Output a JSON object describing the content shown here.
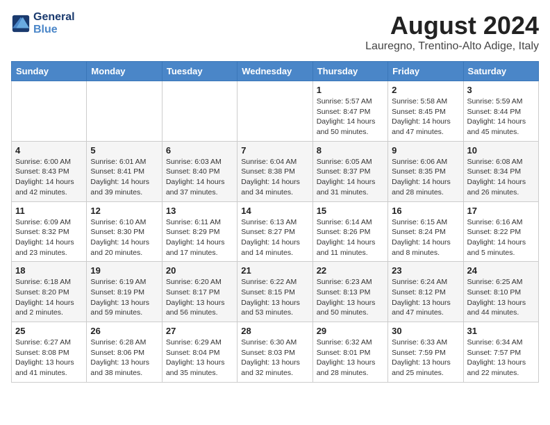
{
  "header": {
    "logo_line1": "General",
    "logo_line2": "Blue",
    "month_year": "August 2024",
    "location": "Lauregno, Trentino-Alto Adige, Italy"
  },
  "weekdays": [
    "Sunday",
    "Monday",
    "Tuesday",
    "Wednesday",
    "Thursday",
    "Friday",
    "Saturday"
  ],
  "weeks": [
    [
      {
        "day": "",
        "info": ""
      },
      {
        "day": "",
        "info": ""
      },
      {
        "day": "",
        "info": ""
      },
      {
        "day": "",
        "info": ""
      },
      {
        "day": "1",
        "info": "Sunrise: 5:57 AM\nSunset: 8:47 PM\nDaylight: 14 hours\nand 50 minutes."
      },
      {
        "day": "2",
        "info": "Sunrise: 5:58 AM\nSunset: 8:45 PM\nDaylight: 14 hours\nand 47 minutes."
      },
      {
        "day": "3",
        "info": "Sunrise: 5:59 AM\nSunset: 8:44 PM\nDaylight: 14 hours\nand 45 minutes."
      }
    ],
    [
      {
        "day": "4",
        "info": "Sunrise: 6:00 AM\nSunset: 8:43 PM\nDaylight: 14 hours\nand 42 minutes."
      },
      {
        "day": "5",
        "info": "Sunrise: 6:01 AM\nSunset: 8:41 PM\nDaylight: 14 hours\nand 39 minutes."
      },
      {
        "day": "6",
        "info": "Sunrise: 6:03 AM\nSunset: 8:40 PM\nDaylight: 14 hours\nand 37 minutes."
      },
      {
        "day": "7",
        "info": "Sunrise: 6:04 AM\nSunset: 8:38 PM\nDaylight: 14 hours\nand 34 minutes."
      },
      {
        "day": "8",
        "info": "Sunrise: 6:05 AM\nSunset: 8:37 PM\nDaylight: 14 hours\nand 31 minutes."
      },
      {
        "day": "9",
        "info": "Sunrise: 6:06 AM\nSunset: 8:35 PM\nDaylight: 14 hours\nand 28 minutes."
      },
      {
        "day": "10",
        "info": "Sunrise: 6:08 AM\nSunset: 8:34 PM\nDaylight: 14 hours\nand 26 minutes."
      }
    ],
    [
      {
        "day": "11",
        "info": "Sunrise: 6:09 AM\nSunset: 8:32 PM\nDaylight: 14 hours\nand 23 minutes."
      },
      {
        "day": "12",
        "info": "Sunrise: 6:10 AM\nSunset: 8:30 PM\nDaylight: 14 hours\nand 20 minutes."
      },
      {
        "day": "13",
        "info": "Sunrise: 6:11 AM\nSunset: 8:29 PM\nDaylight: 14 hours\nand 17 minutes."
      },
      {
        "day": "14",
        "info": "Sunrise: 6:13 AM\nSunset: 8:27 PM\nDaylight: 14 hours\nand 14 minutes."
      },
      {
        "day": "15",
        "info": "Sunrise: 6:14 AM\nSunset: 8:26 PM\nDaylight: 14 hours\nand 11 minutes."
      },
      {
        "day": "16",
        "info": "Sunrise: 6:15 AM\nSunset: 8:24 PM\nDaylight: 14 hours\nand 8 minutes."
      },
      {
        "day": "17",
        "info": "Sunrise: 6:16 AM\nSunset: 8:22 PM\nDaylight: 14 hours\nand 5 minutes."
      }
    ],
    [
      {
        "day": "18",
        "info": "Sunrise: 6:18 AM\nSunset: 8:20 PM\nDaylight: 14 hours\nand 2 minutes."
      },
      {
        "day": "19",
        "info": "Sunrise: 6:19 AM\nSunset: 8:19 PM\nDaylight: 13 hours\nand 59 minutes."
      },
      {
        "day": "20",
        "info": "Sunrise: 6:20 AM\nSunset: 8:17 PM\nDaylight: 13 hours\nand 56 minutes."
      },
      {
        "day": "21",
        "info": "Sunrise: 6:22 AM\nSunset: 8:15 PM\nDaylight: 13 hours\nand 53 minutes."
      },
      {
        "day": "22",
        "info": "Sunrise: 6:23 AM\nSunset: 8:13 PM\nDaylight: 13 hours\nand 50 minutes."
      },
      {
        "day": "23",
        "info": "Sunrise: 6:24 AM\nSunset: 8:12 PM\nDaylight: 13 hours\nand 47 minutes."
      },
      {
        "day": "24",
        "info": "Sunrise: 6:25 AM\nSunset: 8:10 PM\nDaylight: 13 hours\nand 44 minutes."
      }
    ],
    [
      {
        "day": "25",
        "info": "Sunrise: 6:27 AM\nSunset: 8:08 PM\nDaylight: 13 hours\nand 41 minutes."
      },
      {
        "day": "26",
        "info": "Sunrise: 6:28 AM\nSunset: 8:06 PM\nDaylight: 13 hours\nand 38 minutes."
      },
      {
        "day": "27",
        "info": "Sunrise: 6:29 AM\nSunset: 8:04 PM\nDaylight: 13 hours\nand 35 minutes."
      },
      {
        "day": "28",
        "info": "Sunrise: 6:30 AM\nSunset: 8:03 PM\nDaylight: 13 hours\nand 32 minutes."
      },
      {
        "day": "29",
        "info": "Sunrise: 6:32 AM\nSunset: 8:01 PM\nDaylight: 13 hours\nand 28 minutes."
      },
      {
        "day": "30",
        "info": "Sunrise: 6:33 AM\nSunset: 7:59 PM\nDaylight: 13 hours\nand 25 minutes."
      },
      {
        "day": "31",
        "info": "Sunrise: 6:34 AM\nSunset: 7:57 PM\nDaylight: 13 hours\nand 22 minutes."
      }
    ]
  ]
}
